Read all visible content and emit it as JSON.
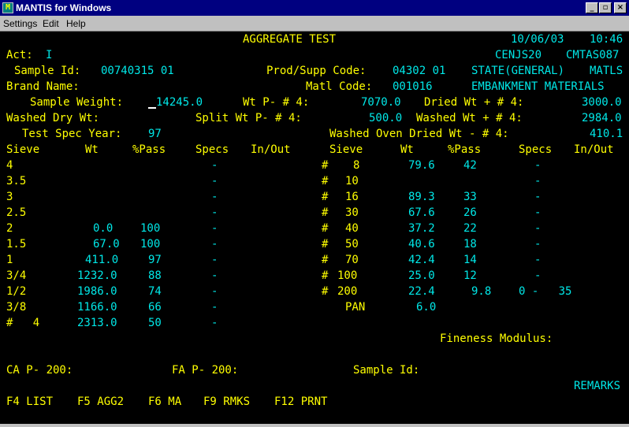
{
  "window": {
    "title": "MANTIS for Windows",
    "minimize": "_",
    "maximize": "▫",
    "close": "×"
  },
  "menu": [
    "Settings",
    "Edit",
    "Help"
  ],
  "header": {
    "screen_title": "AGGREGATE TEST",
    "date": "10/06/03",
    "time": "10:46"
  },
  "line1": {
    "act_label": "Act:",
    "act_value": "I",
    "user": "CENJS20",
    "screen_id": "CMTAS087"
  },
  "line2": {
    "sample_id_label": "Sample Id:",
    "sample_id": "00740315 01",
    "prod_label": "Prod/Supp Code:",
    "prod_code": "04302 01",
    "state": "STATE(GENERAL)",
    "matls": "MATLS"
  },
  "line3": {
    "brand_label": "Brand Name:",
    "matl_label": "Matl Code:",
    "matl_code": "001016",
    "matl_desc": "EMBANKMENT MATERIALS"
  },
  "line4": {
    "sw_label": "Sample Weight:",
    "sw_value": "14245.0",
    "wtp4_label": "Wt P- # 4:",
    "wtp4_value": "7070.0",
    "dried_label": "Dried Wt + # 4:",
    "dried_value": "3000.0"
  },
  "line5": {
    "wdw_label": "Washed Dry Wt:",
    "split_label": "Split Wt P- # 4:",
    "split_value": "500.0",
    "washed_label": "Washed Wt + # 4:",
    "washed_value": "2984.0"
  },
  "line6": {
    "tsy_label": "Test Spec Year:",
    "tsy_value": "97",
    "wod_label": "Washed Oven Dried Wt - # 4:",
    "wod_value": "410.1"
  },
  "columns": {
    "sieve": "Sieve",
    "wt": "Wt",
    "pass": "%Pass",
    "specs": "Specs",
    "inout": "In/Out"
  },
  "left_rows": [
    {
      "sieve": "4",
      "wt": "",
      "pass": "",
      "spec": "-"
    },
    {
      "sieve": "3.5",
      "wt": "",
      "pass": "",
      "spec": "-"
    },
    {
      "sieve": "3",
      "wt": "",
      "pass": "",
      "spec": "-"
    },
    {
      "sieve": "2.5",
      "wt": "",
      "pass": "",
      "spec": "-"
    },
    {
      "sieve": "2",
      "wt": "0.0",
      "pass": "100",
      "spec": "-"
    },
    {
      "sieve": "1.5",
      "wt": "67.0",
      "pass": "100",
      "spec": "-"
    },
    {
      "sieve": "1",
      "wt": "411.0",
      "pass": "97",
      "spec": "-"
    },
    {
      "sieve": "3/4",
      "wt": "1232.0",
      "pass": "88",
      "spec": "-"
    },
    {
      "sieve": "1/2",
      "wt": "1986.0",
      "pass": "74",
      "spec": "-"
    },
    {
      "sieve": "3/8",
      "wt": "1166.0",
      "pass": "66",
      "spec": "-"
    },
    {
      "sieve": "#   4",
      "wt": "2313.0",
      "pass": "50",
      "spec": "-"
    }
  ],
  "right_rows": [
    {
      "hash": "#",
      "sieve": "8",
      "wt": "79.6",
      "pass": "42",
      "spec": "-"
    },
    {
      "hash": "#",
      "sieve": "10",
      "wt": "",
      "pass": "",
      "spec": "-"
    },
    {
      "hash": "#",
      "sieve": "16",
      "wt": "89.3",
      "pass": "33",
      "spec": "-"
    },
    {
      "hash": "#",
      "sieve": "30",
      "wt": "67.6",
      "pass": "26",
      "spec": "-"
    },
    {
      "hash": "#",
      "sieve": "40",
      "wt": "37.2",
      "pass": "22",
      "spec": "-"
    },
    {
      "hash": "#",
      "sieve": "50",
      "wt": "40.6",
      "pass": "18",
      "spec": "-"
    },
    {
      "hash": "#",
      "sieve": "70",
      "wt": "42.4",
      "pass": "14",
      "spec": "-"
    },
    {
      "hash": "#",
      "sieve": "100",
      "wt": "25.0",
      "pass": "12",
      "spec": "-"
    },
    {
      "hash": "#",
      "sieve": "200",
      "wt": "22.4",
      "pass": "9.8",
      "spec": "0 -   35"
    }
  ],
  "pan": {
    "label": "PAN",
    "wt": "6.0"
  },
  "fineness_label": "Fineness Modulus:",
  "bottom": {
    "ca_label": "CA P- 200:",
    "fa_label": "FA P- 200:",
    "sample_id_label": "Sample Id:",
    "remarks": "REMARKS"
  },
  "fkeys": [
    "F4 LIST",
    "F5 AGG2",
    "F6 MA",
    "F9 RMKS",
    "F12 PRNT"
  ],
  "colors": {
    "terminal_bg": "#000000",
    "label": "#ffff00",
    "value": "#00e8e8",
    "titlebar": "#000080"
  }
}
